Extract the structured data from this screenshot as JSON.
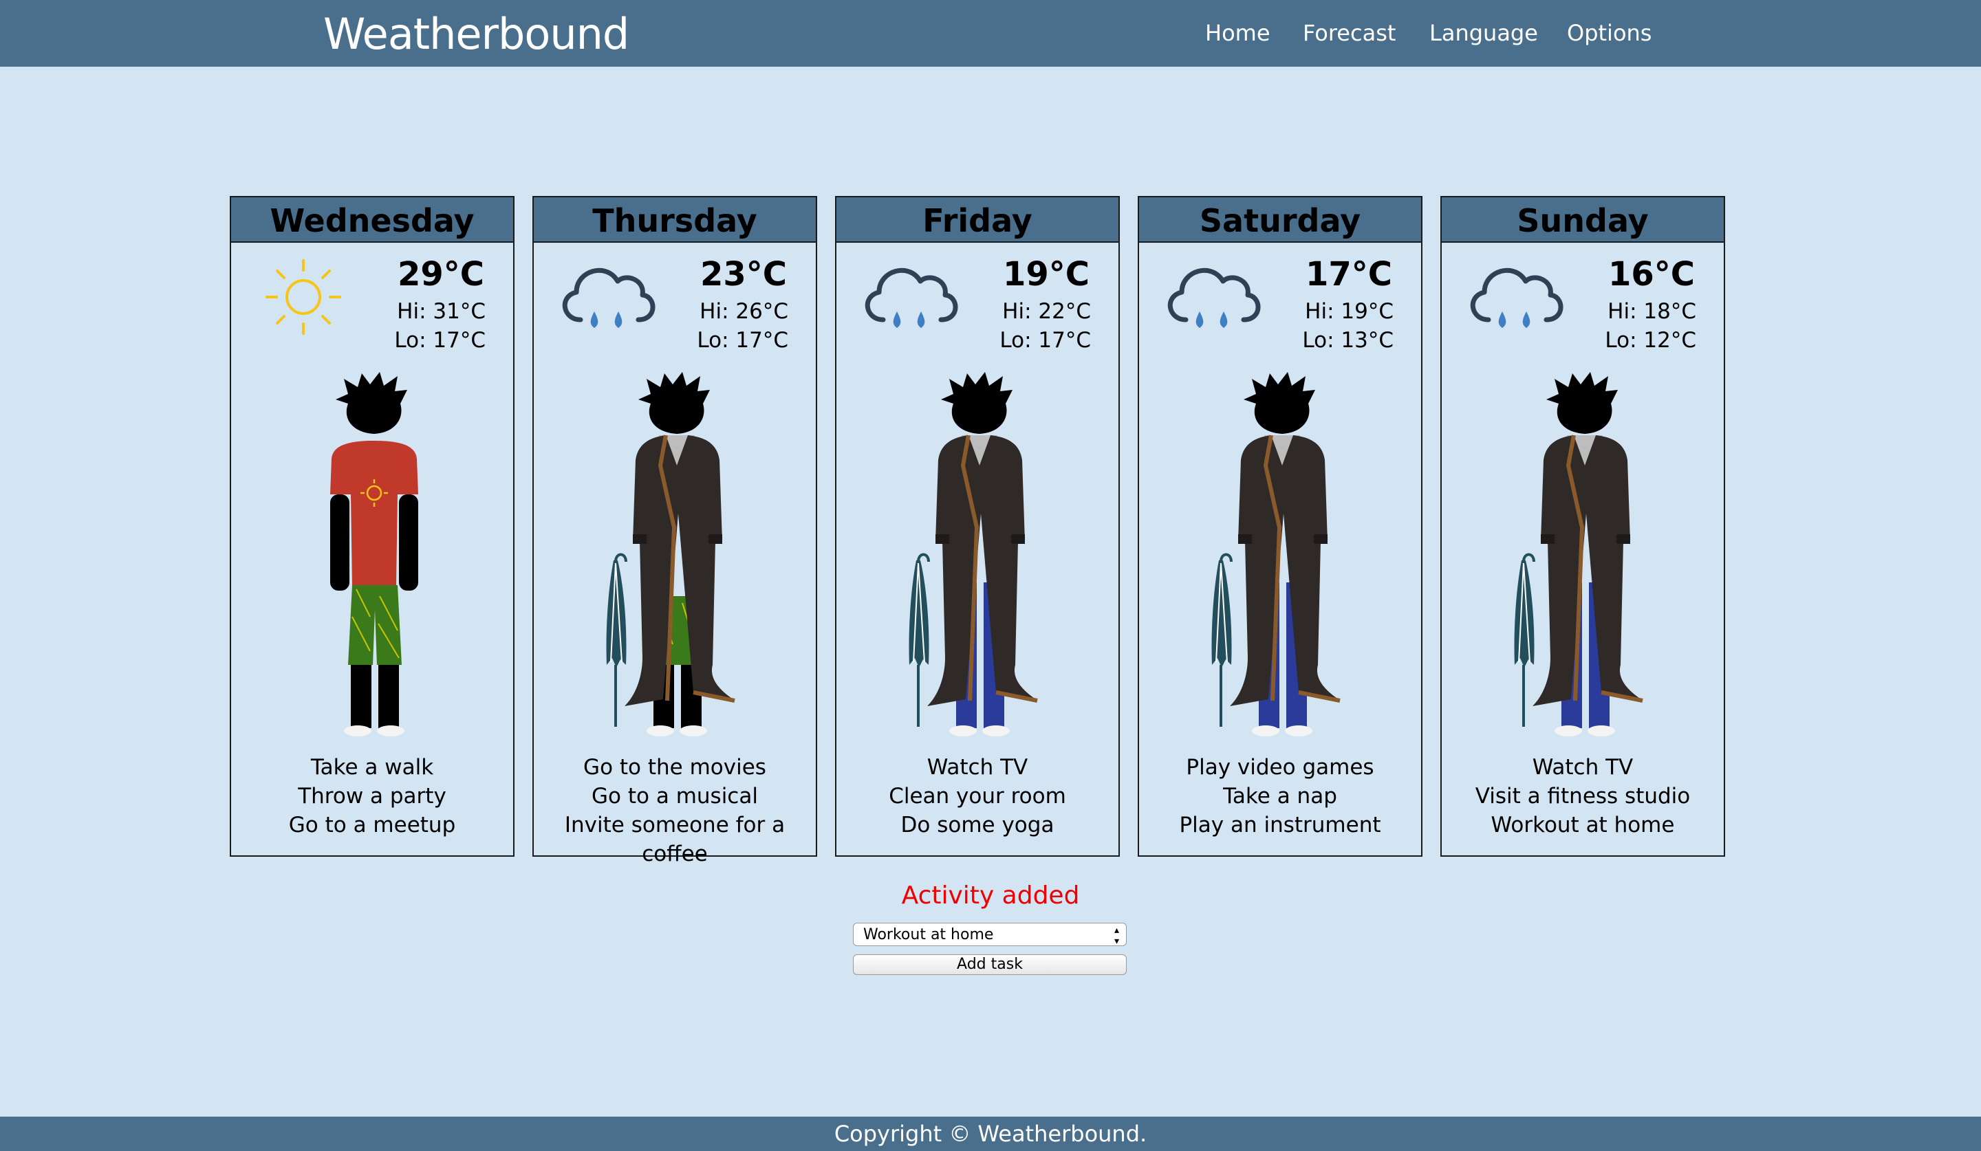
{
  "app": {
    "brand": "Weatherbound"
  },
  "nav": {
    "items": [
      "Home",
      "Forecast",
      "Language",
      "Options"
    ]
  },
  "colors": {
    "navbar": "#4a6f8c",
    "background": "#d3e4f3",
    "sun": "#f5c518",
    "rain_drop": "#3d7fc1",
    "status": "#f00000"
  },
  "days": [
    {
      "name": "Wednesday",
      "icon": "sun-icon",
      "temp": "29°C",
      "hi": "Hi: 31°C",
      "lo": "Lo: 17°C",
      "outfit": "summer-outfit-figure",
      "activities": [
        "Take a walk",
        "Throw a party",
        "Go to a meetup"
      ]
    },
    {
      "name": "Thursday",
      "icon": "rain-cloud-icon",
      "temp": "23°C",
      "hi": "Hi: 26°C",
      "lo": "Lo: 17°C",
      "outfit": "coat-shorts-umbrella-figure",
      "activities": [
        "Go to the movies",
        "Go to a musical",
        "Invite someone for a coffee"
      ]
    },
    {
      "name": "Friday",
      "icon": "rain-cloud-icon",
      "temp": "19°C",
      "hi": "Hi: 22°C",
      "lo": "Lo: 17°C",
      "outfit": "coat-jeans-umbrella-figure",
      "activities": [
        "Watch TV",
        "Clean your room",
        "Do some yoga"
      ]
    },
    {
      "name": "Saturday",
      "icon": "rain-cloud-icon",
      "temp": "17°C",
      "hi": "Hi: 19°C",
      "lo": "Lo: 13°C",
      "outfit": "coat-jeans-umbrella-figure",
      "activities": [
        "Play video games",
        "Take a nap",
        "Play an instrument"
      ]
    },
    {
      "name": "Sunday",
      "icon": "rain-cloud-icon",
      "temp": "16°C",
      "hi": "Hi: 18°C",
      "lo": "Lo: 12°C",
      "outfit": "coat-jeans-umbrella-figure",
      "activities": [
        "Watch TV",
        "Visit a fitness studio",
        "Workout at home"
      ]
    }
  ],
  "task": {
    "status": "Activity added",
    "selected": "Workout at home",
    "button": "Add task"
  },
  "footer": {
    "text": "Copyright © Weatherbound."
  }
}
